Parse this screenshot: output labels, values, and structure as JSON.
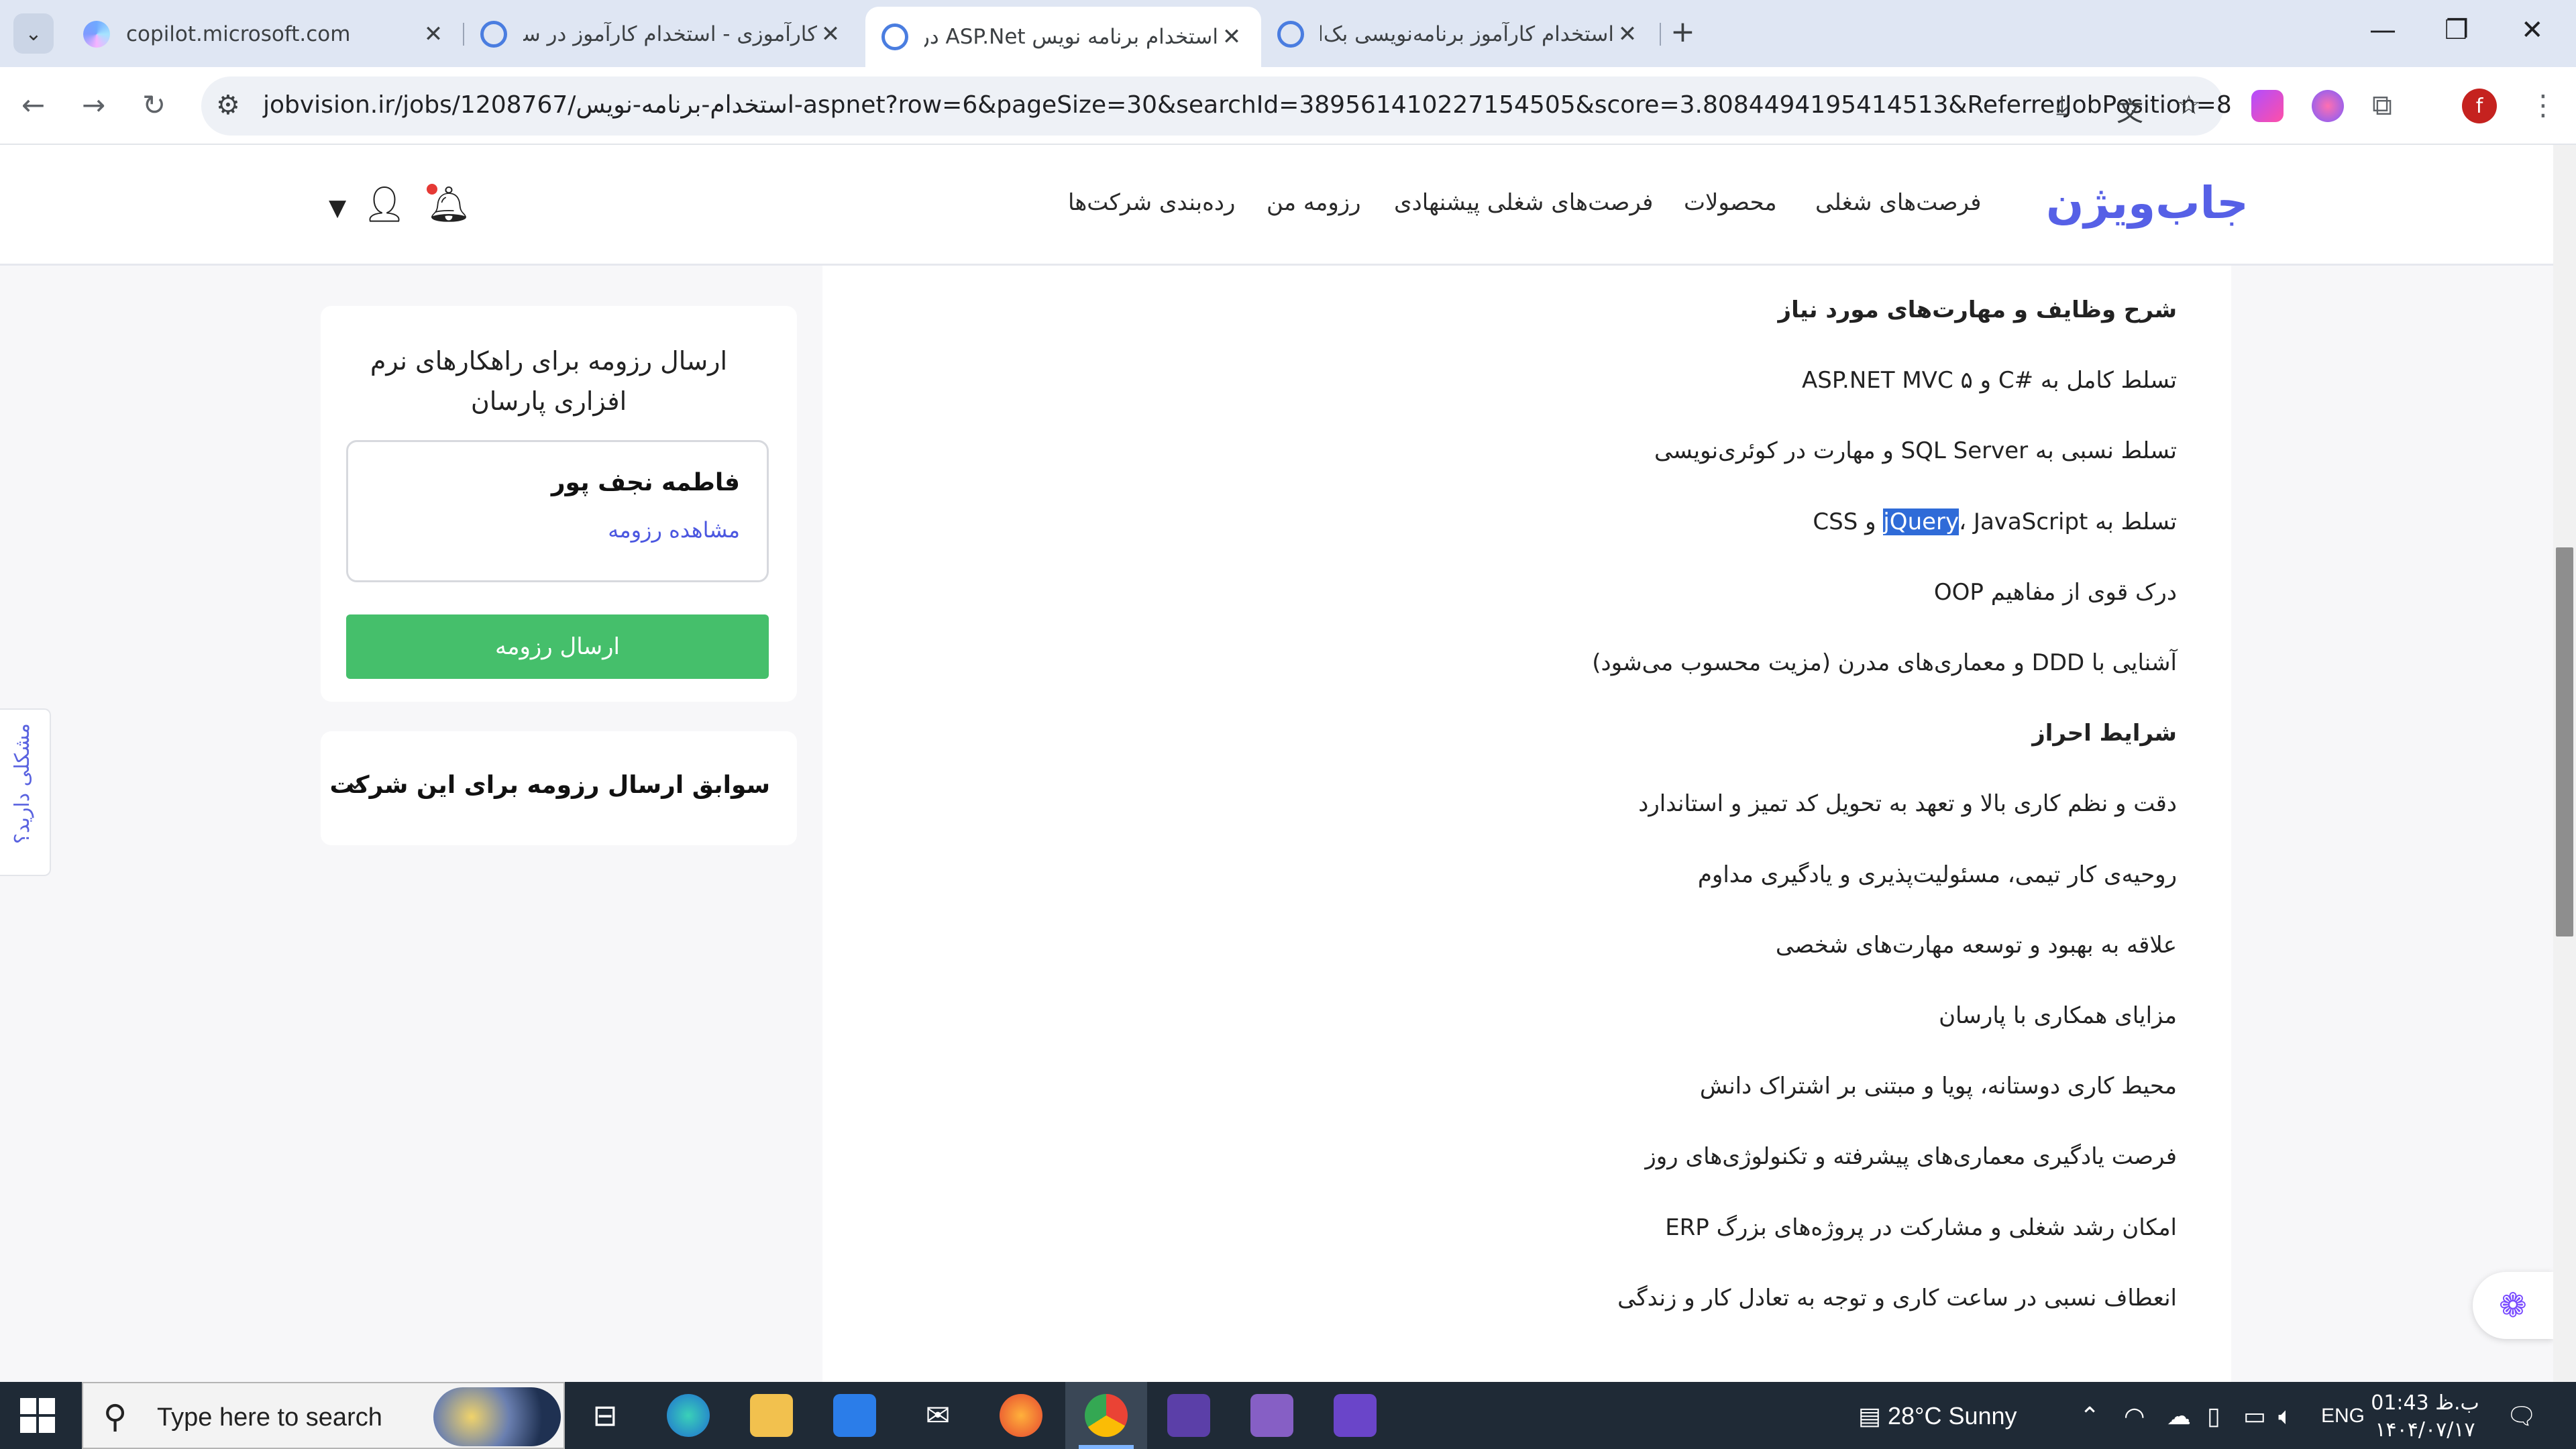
{
  "browser": {
    "tabs": [
      {
        "title": "copilot.microsoft.com",
        "favicon": "copilot-icon",
        "active": false
      },
      {
        "title": "کارآموزی - استخدام کارآموز در سرا",
        "favicon": "jobvision-icon",
        "active": false
      },
      {
        "title": "استخدام برنامه نویس ASP.Net در",
        "favicon": "jobvision-icon",
        "active": true
      },
      {
        "title": "استخدام کارآموز برنامه‌نویسی بک‌ا",
        "favicon": "jobvision-icon",
        "active": false
      }
    ],
    "url": "jobvision.ir/jobs/1208767/استخدام-برنامه-نویس-aspnet?row=6&pageSize=30&searchId=389561410227154505&score=3.8084494195414513&ReferrerJobPosition=8",
    "profile_initial": "f"
  },
  "site": {
    "logo": "جاب‌ویژن",
    "nav": [
      "فرصت‌های شغلی",
      "محصولات",
      "فرصت‌های شغلی پیشنهادی",
      "رزومه من",
      "رده‌بندی شرکت‌ها"
    ]
  },
  "job": {
    "lines": [
      {
        "text": "شرح وظایف و مهارت‌های مورد نیاز",
        "bold": true
      },
      {
        "text": "تسلط کامل به #C و ASP.NET MVC ۵",
        "bold": false
      },
      {
        "text": "تسلط نسبی به SQL Server و مهارت در کوئری‌نویسی",
        "bold": false
      },
      {
        "text_before": "تسلط به ",
        "highlight": "jQuery",
        "text_after": "، JavaScript و CSS",
        "bold": false
      },
      {
        "text": "درک قوی از مفاهیم OOP",
        "bold": false
      },
      {
        "text": "آشنایی با DDD و معماری‌های مدرن (مزیت محسوب می‌شود)",
        "bold": false
      },
      {
        "text": "شرایط احراز",
        "bold": true
      },
      {
        "text": "دقت و نظم کاری بالا و تعهد به تحویل کد تمیز و استاندارد",
        "bold": false
      },
      {
        "text": "روحیه‌ی کار تیمی، مسئولیت‌پذیری و یادگیری مداوم",
        "bold": false
      },
      {
        "text": "علاقه به بهبود و توسعه مهارت‌های شخصی",
        "bold": false
      },
      {
        "text": "مزایای همکاری با پارسان",
        "bold": false
      },
      {
        "text": "محیط کاری دوستانه، پویا و مبتنی بر اشتراک دانش",
        "bold": false
      },
      {
        "text": "فرصت یادگیری معماری‌های پیشرفته و تکنولوژی‌های روز",
        "bold": false
      },
      {
        "text": "امکان رشد شغلی و مشارکت در پروژه‌های بزرگ ERP",
        "bold": false
      },
      {
        "text": "انعطاف نسبی در ساعت کاری و توجه به تعادل کار و زندگی",
        "bold": false
      }
    ]
  },
  "sidebar": {
    "apply_title": "ارسال رزومه برای راهکارهای نرم افزاری پارسان",
    "resume_name": "فاطمه نجف پور",
    "view_resume": "مشاهده رزومه",
    "send_button": "ارسال رزومه",
    "history_title": "سوابق ارسال رزومه برای این شرکت",
    "problem_tab": "مشکلی دارید؟"
  },
  "taskbar": {
    "search_placeholder": "Type here to search",
    "weather": "28°C  Sunny",
    "language": "ENG",
    "time": "01:43 ب.ظ",
    "date": "۱۴۰۴/۰۷/۱۷"
  }
}
